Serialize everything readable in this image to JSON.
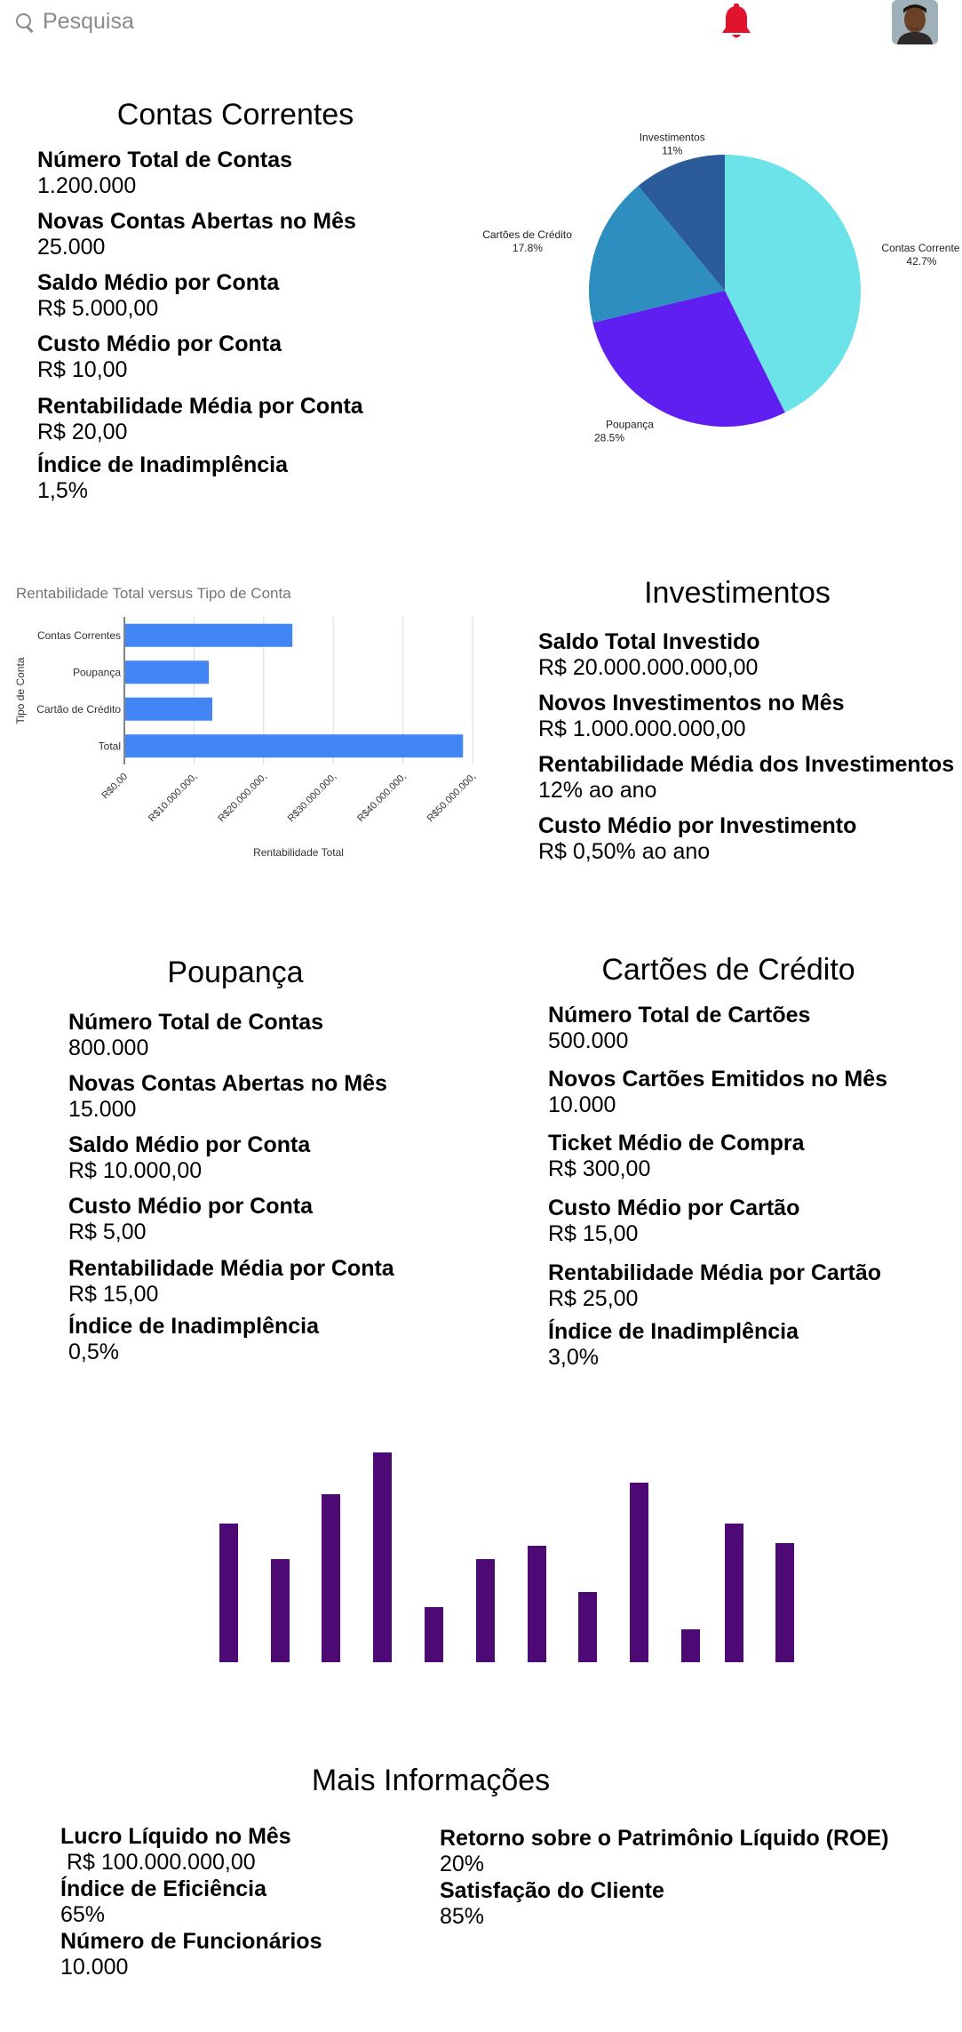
{
  "search": {
    "placeholder": "Pesquisa"
  },
  "colors": {
    "bell": "#e0142d",
    "bars": "#4d0a75",
    "blue_bar": "#4285f4"
  },
  "contas_correntes": {
    "title": "Contas Correntes",
    "metrics": [
      {
        "label": "Número Total de Contas",
        "value": "1.200.000"
      },
      {
        "label": "Novas Contas Abertas no Mês",
        "value": "25.000"
      },
      {
        "label": "Saldo Médio por Conta",
        "value": "R$ 5.000,00"
      },
      {
        "label": "Custo Médio por Conta",
        "value": "R$ 10,00"
      },
      {
        "label": "Rentabilidade Média por Conta",
        "value": "R$ 20,00"
      },
      {
        "label": "Índice de Inadimplência",
        "value": "1,5%"
      }
    ]
  },
  "pie_chart": {
    "chart_data": {
      "type": "pie",
      "slices": [
        {
          "label": "Contas Correntes",
          "pct_label": "42.7%",
          "value": 42.7,
          "color": "#6be3e9"
        },
        {
          "label": "Poupança",
          "pct_label": "28.5%",
          "value": 28.5,
          "color": "#5f1ff0"
        },
        {
          "label": "Cartões de Crédito",
          "pct_label": "17.8%",
          "value": 17.8,
          "color": "#2e8ec0"
        },
        {
          "label": "Investimentos",
          "pct_label": "11%",
          "value": 11,
          "color": "#2c5b9b"
        }
      ]
    }
  },
  "bar_chart": {
    "chart_data": {
      "type": "bar",
      "orientation": "horizontal",
      "title": "Rentabilidade Total versus Tipo de Conta",
      "xlabel": "Rentabilidade Total",
      "ylabel": "Tipo de Conta",
      "categories": [
        "Contas Correntes",
        "Poupança",
        "Cartão de Crédito",
        "Total"
      ],
      "values": [
        24000000,
        12000000,
        12500000,
        48500000
      ],
      "xlim": [
        0,
        50000000
      ],
      "x_ticks": [
        "R$0,00",
        "R$10.000.000,",
        "R$20.000.000,",
        "R$30.000.000,",
        "R$40.000.000,",
        "R$50.000.000,"
      ],
      "grid": true
    }
  },
  "investimentos": {
    "title": "Investimentos",
    "metrics": [
      {
        "label": "Saldo Total Investido",
        "value": "R$ 20.000.000.000,00"
      },
      {
        "label": "Novos Investimentos no Mês",
        "value": "R$ 1.000.000.000,00"
      },
      {
        "label": "Rentabilidade Média dos Investimentos",
        "value": "12% ao ano"
      },
      {
        "label": "Custo Médio por Investimento",
        "value": "R$ 0,50% ao ano"
      }
    ]
  },
  "poupanca": {
    "title": "Poupança",
    "metrics": [
      {
        "label": "Número Total de Contas",
        "value": "800.000"
      },
      {
        "label": "Novas Contas Abertas no Mês",
        "value": "15.000"
      },
      {
        "label": "Saldo Médio por Conta",
        "value": "R$ 10.000,00"
      },
      {
        "label": "Custo Médio por Conta",
        "value": "R$ 5,00"
      },
      {
        "label": "Rentabilidade Média por Conta",
        "value": "R$ 15,00"
      },
      {
        "label": "Índice de Inadimplência",
        "value": "0,5%"
      }
    ]
  },
  "cartoes": {
    "title": "Cartões de Crédito",
    "metrics": [
      {
        "label": "Número Total de Cartões",
        "value": "500.000"
      },
      {
        "label": "Novos Cartões Emitidos no Mês",
        "value": "10.000"
      },
      {
        "label": "Ticket Médio de Compra",
        "value": "R$ 300,00"
      },
      {
        "label": "Custo Médio por Cartão",
        "value": "R$ 15,00"
      },
      {
        "label": "Rentabilidade Média por Cartão",
        "value": "R$ 25,00"
      },
      {
        "label": "Índice de Inadimplência",
        "value": "3,0%"
      }
    ]
  },
  "column_chart": {
    "chart_data": {
      "type": "bar",
      "values": [
        156,
        116,
        189,
        236,
        62,
        116,
        131,
        79,
        202,
        37,
        156,
        134
      ],
      "ylim": [
        0,
        240
      ]
    }
  },
  "mais_informacoes": {
    "title": "Mais Informações",
    "left": [
      {
        "label": "Lucro Líquido no Mês",
        "value": " R$ 100.000.000,00"
      },
      {
        "label": "Índice de Eficiência",
        "value": "65%"
      },
      {
        "label": "Número de Funcionários",
        "value": "10.000"
      }
    ],
    "right": [
      {
        "label": "Retorno sobre o Patrimônio Líquido (ROE)",
        "value": "20%"
      },
      {
        "label": "Satisfação do Cliente",
        "value": "85%"
      }
    ]
  }
}
